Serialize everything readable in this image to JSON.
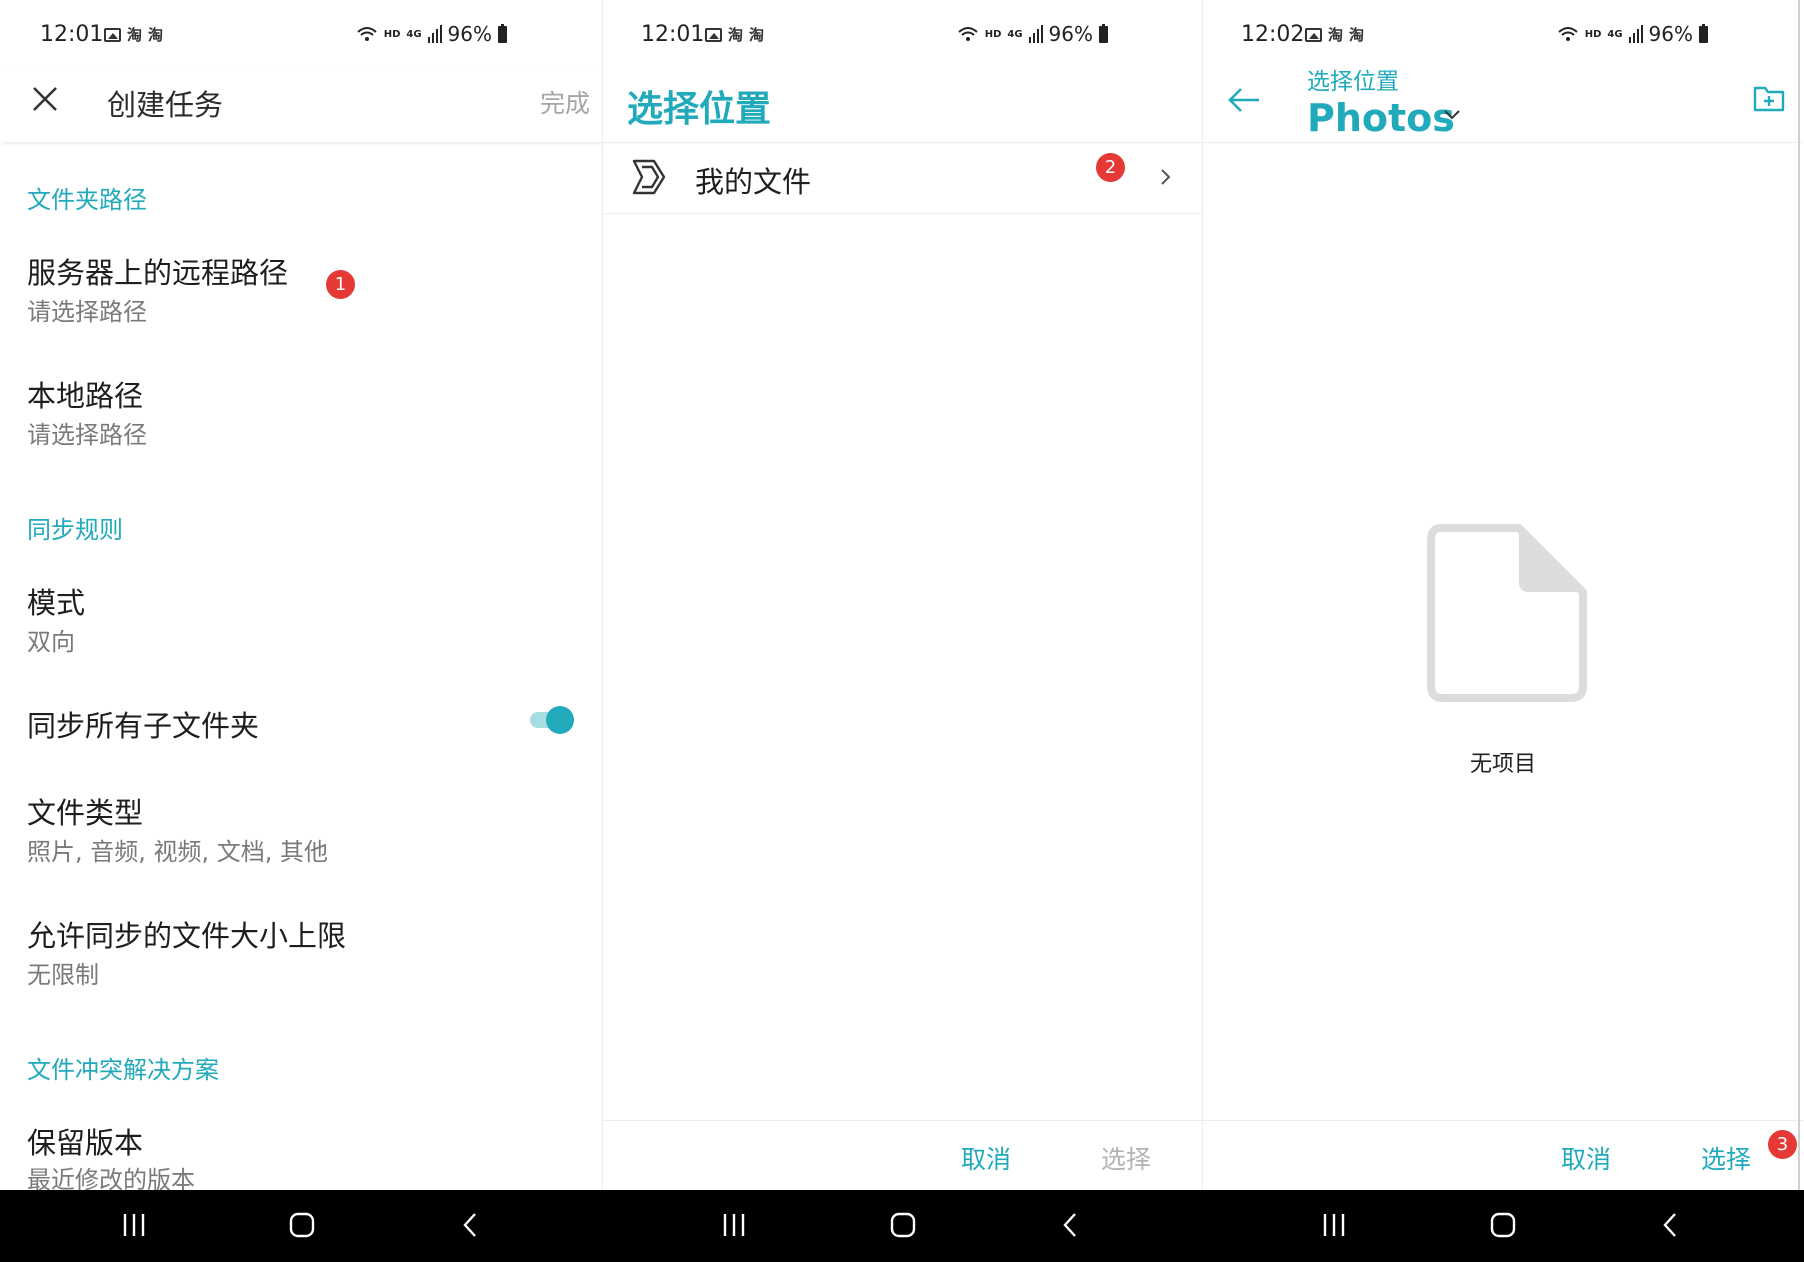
{
  "status_bars": [
    {
      "time": "12:01",
      "battery": "96%"
    },
    {
      "time": "12:01",
      "battery": "96%"
    },
    {
      "time": "12:02",
      "battery": "96%"
    }
  ],
  "status_labels": {
    "hd": "HD",
    "network": "4G"
  },
  "panel1": {
    "header": {
      "title": "创建任务",
      "done_label": "完成"
    },
    "sections": {
      "folder_path": "文件夹路径",
      "sync_rules": "同步规则",
      "conflict": "文件冲突解决方案"
    },
    "items": {
      "remote_path": {
        "title": "服务器上的远程路径",
        "subtitle": "请选择路径"
      },
      "local_path": {
        "title": "本地路径",
        "subtitle": "请选择路径"
      },
      "mode": {
        "title": "模式",
        "subtitle": "双向"
      },
      "sync_subfolders": {
        "title": "同步所有子文件夹",
        "enabled": true
      },
      "file_types": {
        "title": "文件类型",
        "subtitle": "照片, 音频, 视频, 文档, 其他"
      },
      "size_limit": {
        "title": "允许同步的文件大小上限",
        "subtitle": "无限制"
      },
      "keep_version": {
        "title": "保留版本",
        "subtitle": "最近修改的版本"
      }
    },
    "badge": "1"
  },
  "panel2": {
    "title": "选择位置",
    "row_label": "我的文件",
    "badge": "2",
    "cancel_label": "取消",
    "select_label": "选择"
  },
  "panel3": {
    "subtitle": "选择位置",
    "title": "Photos",
    "empty_text": "无项目",
    "cancel_label": "取消",
    "select_label": "选择",
    "badge": "3"
  },
  "colors": {
    "accent": "#21aabb",
    "badge": "#e53935",
    "muted": "#7a7a7a",
    "disabled": "#b3b3b3"
  }
}
